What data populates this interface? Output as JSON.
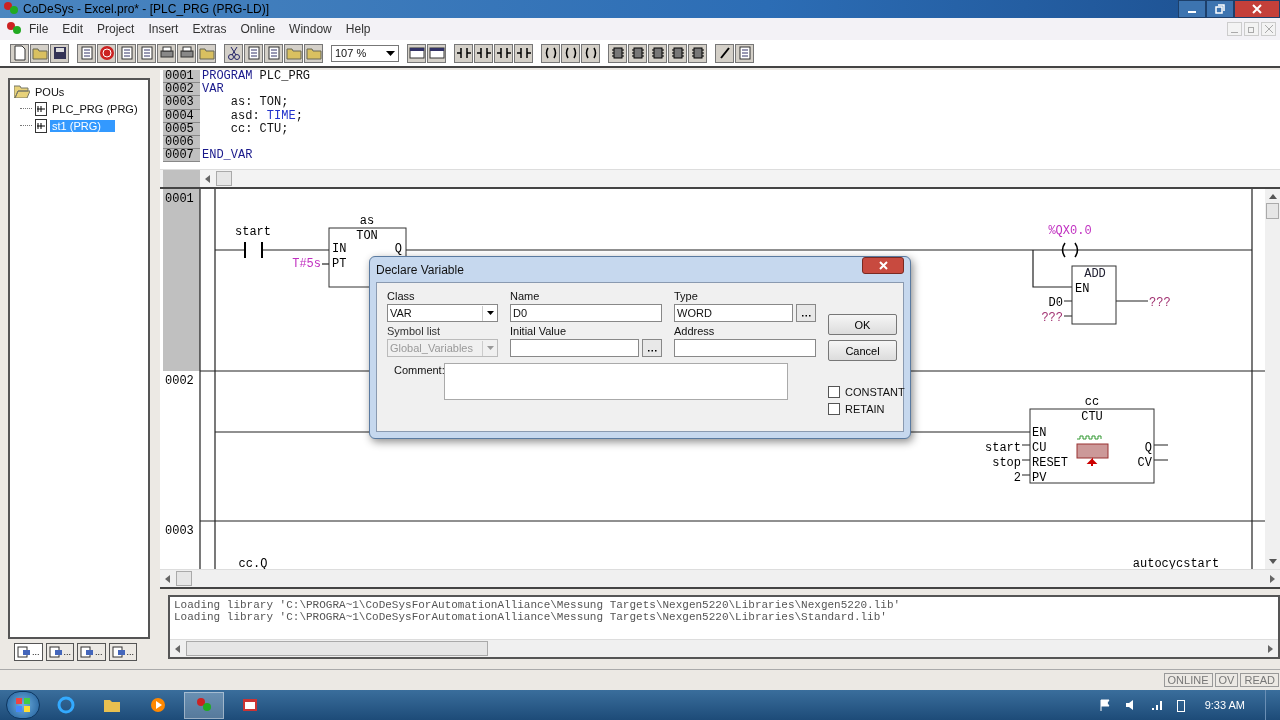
{
  "window": {
    "title": "CoDeSys - Excel.pro* - [PLC_PRG (PRG-LD)]"
  },
  "menu": [
    "File",
    "Edit",
    "Project",
    "Insert",
    "Extras",
    "Online",
    "Window",
    "Help"
  ],
  "toolbar": {
    "zoom": "107 %"
  },
  "pou_tree": {
    "label": "POUs",
    "expanded": true,
    "children": [
      {
        "label": "PLC_PRG (PRG)",
        "selected": false
      },
      {
        "label": "st1 (PRG)",
        "selected": true
      }
    ]
  },
  "object_tabs": [
    {
      "label": "...",
      "selected": true
    },
    {
      "label": "...",
      "selected": false
    },
    {
      "label": "...",
      "selected": false
    },
    {
      "label": "...",
      "selected": false
    }
  ],
  "declaration": {
    "lines": [
      {
        "number": "0001",
        "segments": [
          {
            "text": "PROGRAM",
            "kind": "keyword"
          },
          {
            "text": " PLC_PRG",
            "kind": "plain"
          }
        ]
      },
      {
        "number": "0002",
        "segments": [
          {
            "text": "VAR",
            "kind": "keyword"
          }
        ]
      },
      {
        "number": "0003",
        "segments": [
          {
            "text": "    as: TON;",
            "kind": "plain"
          }
        ]
      },
      {
        "number": "0004",
        "segments": [
          {
            "text": "    asd: ",
            "kind": "plain"
          },
          {
            "text": "TIME",
            "kind": "type"
          },
          {
            "text": ";",
            "kind": "plain"
          }
        ]
      },
      {
        "number": "0005",
        "segments": [
          {
            "text": "    cc: CTU;",
            "kind": "plain"
          }
        ]
      },
      {
        "number": "0006"
      },
      {
        "number": "0007",
        "segments": [
          {
            "text": "END_VAR",
            "kind": "keyword"
          }
        ]
      }
    ]
  },
  "ladder": {
    "networks": [
      {
        "number": "0001",
        "selected": true
      },
      {
        "number": "0002",
        "selected": false
      },
      {
        "number": "0003",
        "selected": false
      }
    ],
    "contact": "start",
    "timer": {
      "instance": "as",
      "type": "TON",
      "inputs": [
        "IN",
        "PT"
      ],
      "output": "Q",
      "preset": "T#5s"
    },
    "coil": "%QX0.0",
    "add": {
      "type": "ADD",
      "enable": "EN",
      "inputs": [
        "D0",
        "???"
      ],
      "output": "???"
    },
    "counter": {
      "instance": "cc",
      "type": "CTU",
      "pins": [
        "EN",
        "CU",
        "RESET",
        "PV"
      ],
      "inputs": [
        "start",
        "stop",
        "2"
      ],
      "outputs": [
        "Q",
        "CV"
      ]
    },
    "network3": {
      "contact": "cc.Q",
      "coil": "autocycstart"
    }
  },
  "dialog": {
    "title": "Declare Variable",
    "fields": [
      {
        "label": "Class",
        "value": "VAR",
        "kind": "combo",
        "disabled": false
      },
      {
        "label": "Name",
        "value": "D0",
        "kind": "text",
        "disabled": false
      },
      {
        "label": "Type",
        "value": "WORD",
        "kind": "browse",
        "disabled": false
      },
      {
        "label": "Symbol list",
        "value": "Global_Variables",
        "kind": "combo",
        "disabled": true
      },
      {
        "label": "Initial Value",
        "kind": "browse",
        "disabled": false
      },
      {
        "label": "Address",
        "kind": "text",
        "disabled": false
      }
    ],
    "comment_label": "Comment:",
    "buttons": [
      "OK",
      "Cancel"
    ],
    "checkboxes": [
      {
        "label": "CONSTANT",
        "checked": false
      },
      {
        "label": "RETAIN",
        "checked": false
      }
    ]
  },
  "messages": [
    "Loading library 'C:\\PROGRA~1\\CoDeSysForAutomationAlliance\\Messung Targets\\Nexgen5220\\Libraries\\Nexgen5220.lib'",
    "Loading library 'C:\\PROGRA~1\\CoDeSysForAutomationAlliance\\Messung Targets\\Nexgen5220\\Libraries\\Standard.lib'"
  ],
  "status_bar": [
    "ONLINE",
    "OV",
    "READ"
  ],
  "taskbar": {
    "time": "9:33 AM"
  }
}
